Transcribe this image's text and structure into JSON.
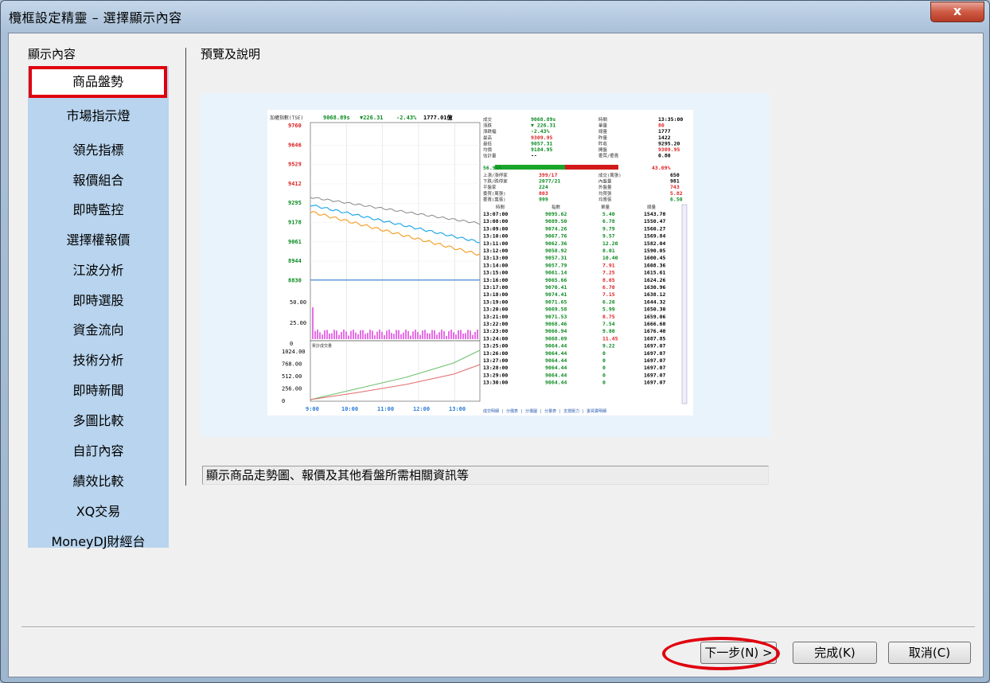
{
  "window": {
    "title": "欖框設定精靈 – 選擇顯示內容",
    "close_label": "x"
  },
  "left_panel": {
    "heading": "顯示內容",
    "items": [
      {
        "label": "商品盤勢",
        "selected": true
      },
      {
        "label": "市場指示燈"
      },
      {
        "label": "領先指標"
      },
      {
        "label": "報價組合"
      },
      {
        "label": "即時監控"
      },
      {
        "label": "選擇權報價"
      },
      {
        "label": "江波分析"
      },
      {
        "label": "即時選股"
      },
      {
        "label": "資金流向"
      },
      {
        "label": "技術分析"
      },
      {
        "label": "即時新聞"
      },
      {
        "label": "多圖比較"
      },
      {
        "label": "自訂內容"
      },
      {
        "label": "績效比較"
      },
      {
        "label": "XQ交易"
      },
      {
        "label": "MoneyDJ財經台"
      }
    ]
  },
  "right_panel": {
    "heading": "預覽及說明",
    "description": "顯示商品走勢圖、報價及其他看盤所需相關資訊等"
  },
  "preview": {
    "header": "加權指數(TSE)",
    "index_value": "9068.89s",
    "change": "▼226.31",
    "pct": "-2.43%",
    "volume": "1777.01億",
    "y_ticks": [
      "9760",
      "9646",
      "9529",
      "9412",
      "9295",
      "9178",
      "9061",
      "8944",
      "8830"
    ],
    "vol_ticks": [
      "50.00",
      "25.00",
      "0"
    ],
    "vol_label": "累計成交量",
    "cum_ticks": [
      "1024.00",
      "768.00",
      "512.00",
      "256.00",
      "0"
    ],
    "x_ticks": [
      "9:00",
      "10:00",
      "11:00",
      "12:00",
      "13:00"
    ],
    "quote_left": [
      [
        "成交",
        "9068.89s"
      ],
      [
        "漲跌",
        "▼ 226.31"
      ],
      [
        "漲跌幅",
        "-2.43%"
      ],
      [
        "最高",
        "9309.95"
      ],
      [
        "最低",
        "9057.31"
      ],
      [
        "均價",
        "9184.95"
      ],
      [
        "估計量",
        "--"
      ]
    ],
    "quote_right": [
      [
        "時間",
        "13:35:00"
      ],
      [
        "單量",
        "80"
      ],
      [
        "總量",
        "1777"
      ],
      [
        "昨量",
        "1422"
      ],
      [
        "昨收",
        "9295.20"
      ],
      [
        "開盤",
        "9309.95"
      ],
      [
        "委買/委賣",
        "0.80"
      ]
    ],
    "inner_pct": "56.91%",
    "outer_pct": "43.09%",
    "stats_left": [
      [
        "上漲/漲停家",
        "399/17"
      ],
      [
        "下跌/跌停家",
        "2077/21"
      ],
      [
        "平盤家",
        "224"
      ],
      [
        "委買(萬張)",
        "803"
      ],
      [
        "委賣(萬張)",
        "999"
      ]
    ],
    "stats_right": [
      [
        "成交(萬張)",
        "650"
      ],
      [
        "內盤量",
        "981"
      ],
      [
        "外盤量",
        "743"
      ],
      [
        "均買張",
        "5.82"
      ],
      [
        "均賣張",
        "6.50"
      ]
    ],
    "tick_headers": [
      "時間",
      "指數",
      "單量",
      "總量"
    ],
    "ticks": [
      [
        "13:07:00",
        "9095.62",
        "5.40",
        "1543.70"
      ],
      [
        "13:08:00",
        "9089.50",
        "6.78",
        "1550.47"
      ],
      [
        "13:09:00",
        "9074.26",
        "9.79",
        "1560.27"
      ],
      [
        "13:10:00",
        "9067.76",
        "9.57",
        "1569.84"
      ],
      [
        "13:11:00",
        "9062.36",
        "12.20",
        "1582.04"
      ],
      [
        "13:12:00",
        "9058.92",
        "8.01",
        "1590.05"
      ],
      [
        "13:13:00",
        "9057.31",
        "10.40",
        "1600.45"
      ],
      [
        "13:14:00",
        "9057.79",
        "7.91",
        "1608.36"
      ],
      [
        "13:15:00",
        "9061.14",
        "7.25",
        "1615.61"
      ],
      [
        "13:16:00",
        "9065.66",
        "8.65",
        "1624.26"
      ],
      [
        "13:17:00",
        "9070.41",
        "6.70",
        "1630.96"
      ],
      [
        "13:18:00",
        "9074.41",
        "7.15",
        "1638.12"
      ],
      [
        "13:19:00",
        "9071.65",
        "6.20",
        "1644.32"
      ],
      [
        "13:20:00",
        "9069.58",
        "5.99",
        "1650.30"
      ],
      [
        "13:21:00",
        "9071.53",
        "8.75",
        "1659.06"
      ],
      [
        "13:22:00",
        "9068.46",
        "7.54",
        "1666.60"
      ],
      [
        "13:23:00",
        "9066.94",
        "9.80",
        "1676.40"
      ],
      [
        "13:24:00",
        "9068.09",
        "11.45",
        "1687.85"
      ],
      [
        "13:25:00",
        "9064.44",
        "9.22",
        "1697.07"
      ],
      [
        "13:26:00",
        "9064.44",
        "0",
        "1697.07"
      ],
      [
        "13:27:00",
        "9064.44",
        "0",
        "1697.07"
      ],
      [
        "13:28:00",
        "9064.44",
        "0",
        "1697.07"
      ],
      [
        "13:29:00",
        "9064.44",
        "0",
        "1697.07"
      ],
      [
        "13:30:00",
        "9064.44",
        "0",
        "1697.07"
      ]
    ],
    "tabs": "成交明細 | 分價表 | 分價圖 | 分量表 | 支撐壓力 | 委買賣明細"
  },
  "buttons": {
    "next": "下一步(N) >",
    "finish": "完成(K)",
    "cancel": "取消(C)"
  }
}
